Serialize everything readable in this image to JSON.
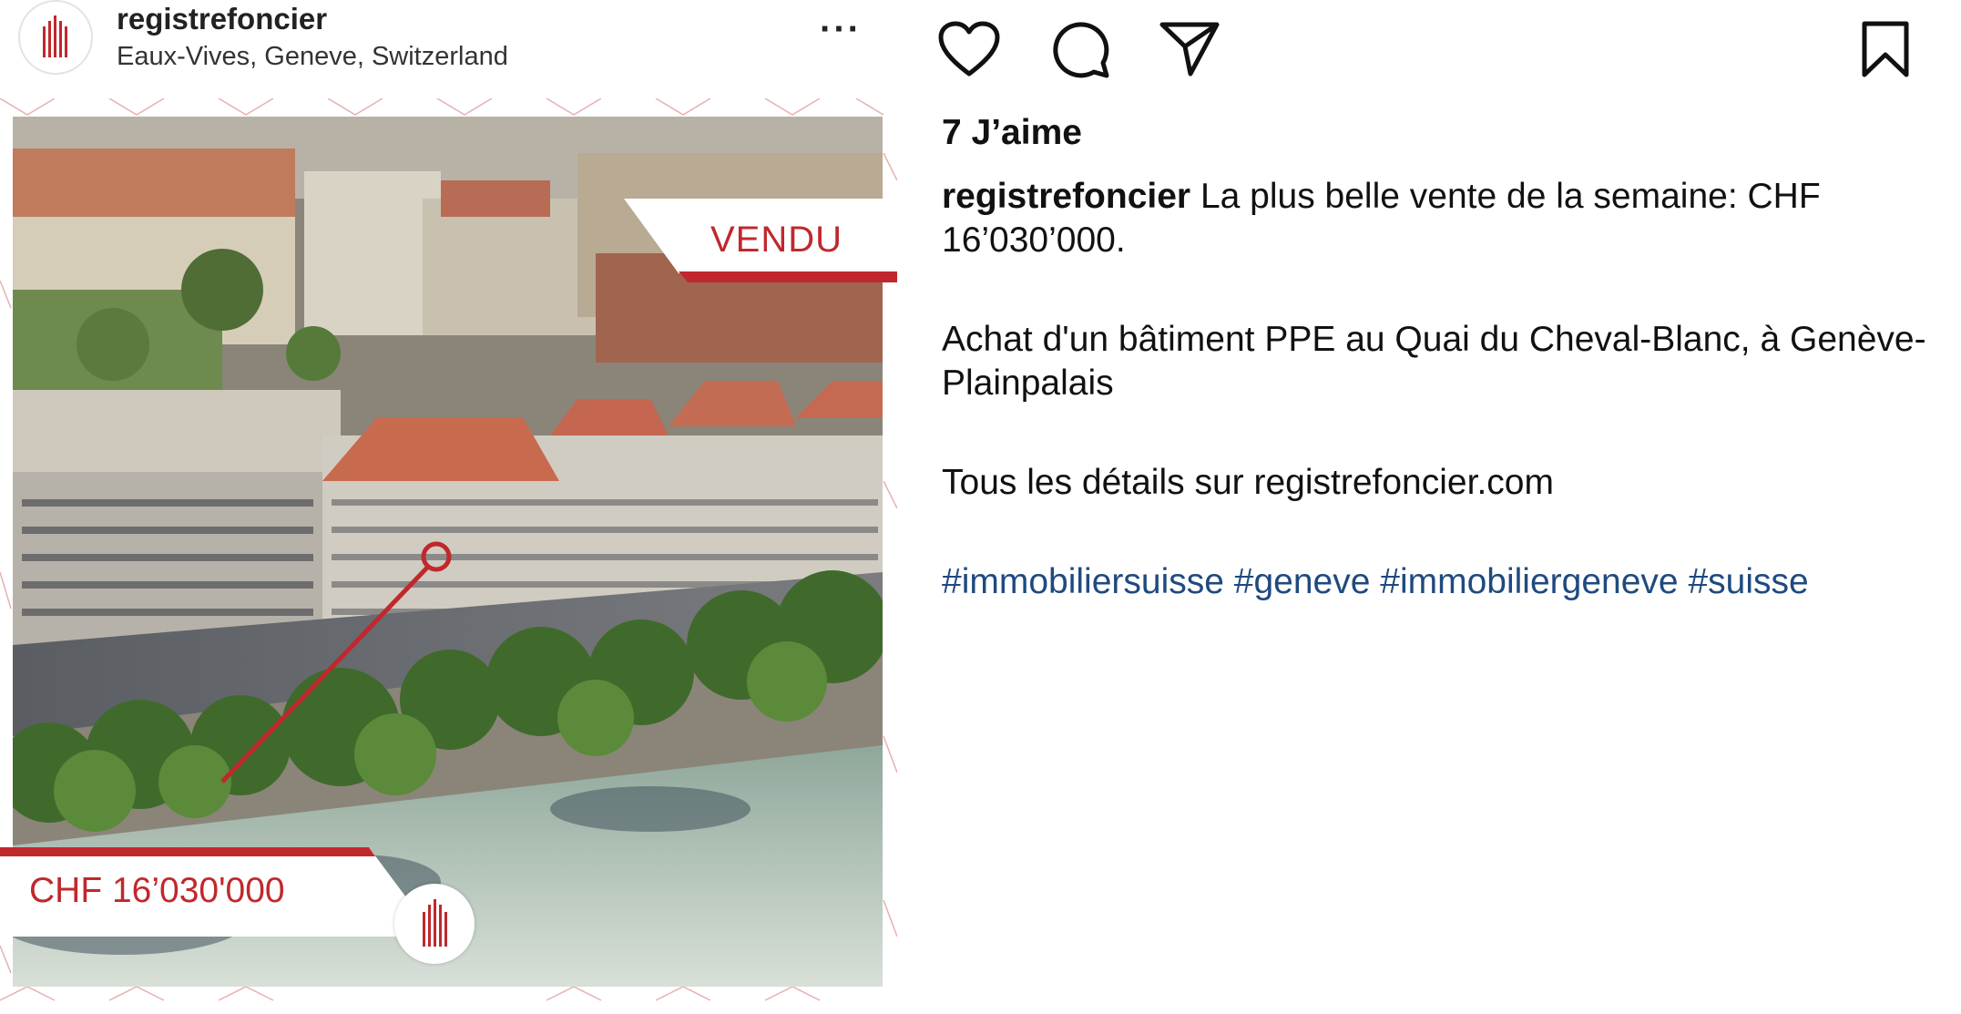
{
  "header": {
    "username": "registrefoncier",
    "location": "Eaux-Vives, Geneve, Switzerland",
    "more_label": "···"
  },
  "post_image": {
    "sold_label": "VENDU",
    "price_label": "CHF 16’030'000",
    "accent_color": "#c0282d"
  },
  "actions": {
    "icons": [
      "heart-icon",
      "comment-icon",
      "share-icon",
      "bookmark-icon"
    ]
  },
  "likes": "7 J’aime",
  "caption": {
    "username": "registrefoncier",
    "line1": "La plus belle vente de la semaine: CHF 16’030’000.",
    "line2": "Achat d'un bâtiment PPE au Quai du Cheval-Blanc, à Genève-Plainpalais",
    "line3": "Tous les détails sur registrefoncier.com",
    "hashtags": [
      "#immobiliersuisse",
      "#geneve",
      "#immobiliergeneve",
      "#suisse"
    ],
    "hashtag_color": "#1f4a7e"
  }
}
